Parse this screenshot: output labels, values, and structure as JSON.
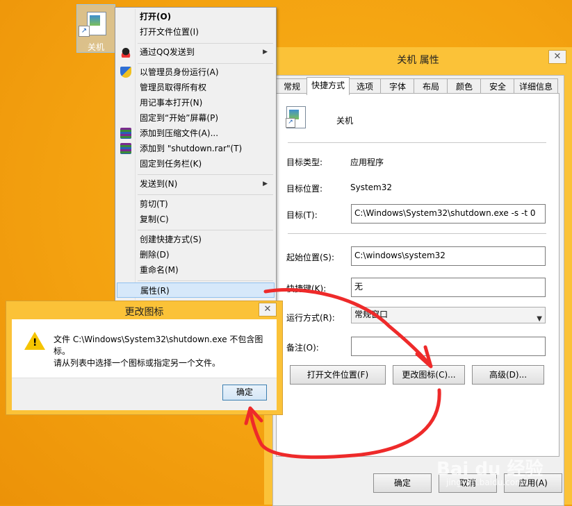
{
  "desktop_icon": {
    "label": "关机"
  },
  "context_menu": {
    "items": [
      {
        "label": "打开(O)",
        "bold": true
      },
      {
        "label": "打开文件位置(I)"
      },
      {
        "label": "通过QQ发送到"
      },
      {
        "label": "以管理员身份运行(A)"
      },
      {
        "label": "管理员取得所有权"
      },
      {
        "label": "用记事本打开(N)"
      },
      {
        "label": "固定到“开始”屏幕(P)"
      },
      {
        "label": "添加到压缩文件(A)..."
      },
      {
        "label": "添加到 \"shutdown.rar\"(T)"
      },
      {
        "label": "固定到任务栏(K)"
      },
      {
        "label": "发送到(N)"
      },
      {
        "label": "剪切(T)"
      },
      {
        "label": "复制(C)"
      },
      {
        "label": "创建快捷方式(S)"
      },
      {
        "label": "删除(D)"
      },
      {
        "label": "重命名(M)"
      },
      {
        "label": "属性(R)"
      }
    ]
  },
  "properties": {
    "title": "关机 属性",
    "close_glyph": "✕",
    "tabs": [
      "常规",
      "快捷方式",
      "选项",
      "字体",
      "布局",
      "颜色",
      "安全",
      "详细信息"
    ],
    "active_tab": "快捷方式",
    "name": "关机",
    "target_type_label": "目标类型:",
    "target_type_value": "应用程序",
    "target_location_label": "目标位置:",
    "target_location_value": "System32",
    "target_label": "目标(T):",
    "target_value": "C:\\Windows\\System32\\shutdown.exe -s -t 0",
    "start_in_label": "起始位置(S):",
    "start_in_value": "C:\\windows\\system32",
    "hotkey_label": "快捷键(K):",
    "hotkey_value": "无",
    "run_label": "运行方式(R):",
    "run_value": "常规窗口",
    "comment_label": "备注(O):",
    "comment_value": "",
    "btn_open_location": "打开文件位置(F)",
    "btn_change_icon": "更改图标(C)...",
    "btn_advanced": "高级(D)...",
    "btn_ok": "确定",
    "btn_cancel": "取消",
    "btn_apply": "应用(A)"
  },
  "change_icon_dialog": {
    "title": "更改图标",
    "close_glyph": "✕",
    "message1": "文件 C:\\Windows\\System32\\shutdown.exe 不包含图标。",
    "message2": "请从列表中选择一个图标或指定另一个文件。",
    "btn_ok": "确定"
  },
  "watermark": {
    "brand": "Bai du 经验",
    "url": "jingyan.baidu.com"
  },
  "colors": {
    "desktop": "#f4a210",
    "annotation": "#ee2a2a",
    "highlight": "#d6e8fa"
  }
}
